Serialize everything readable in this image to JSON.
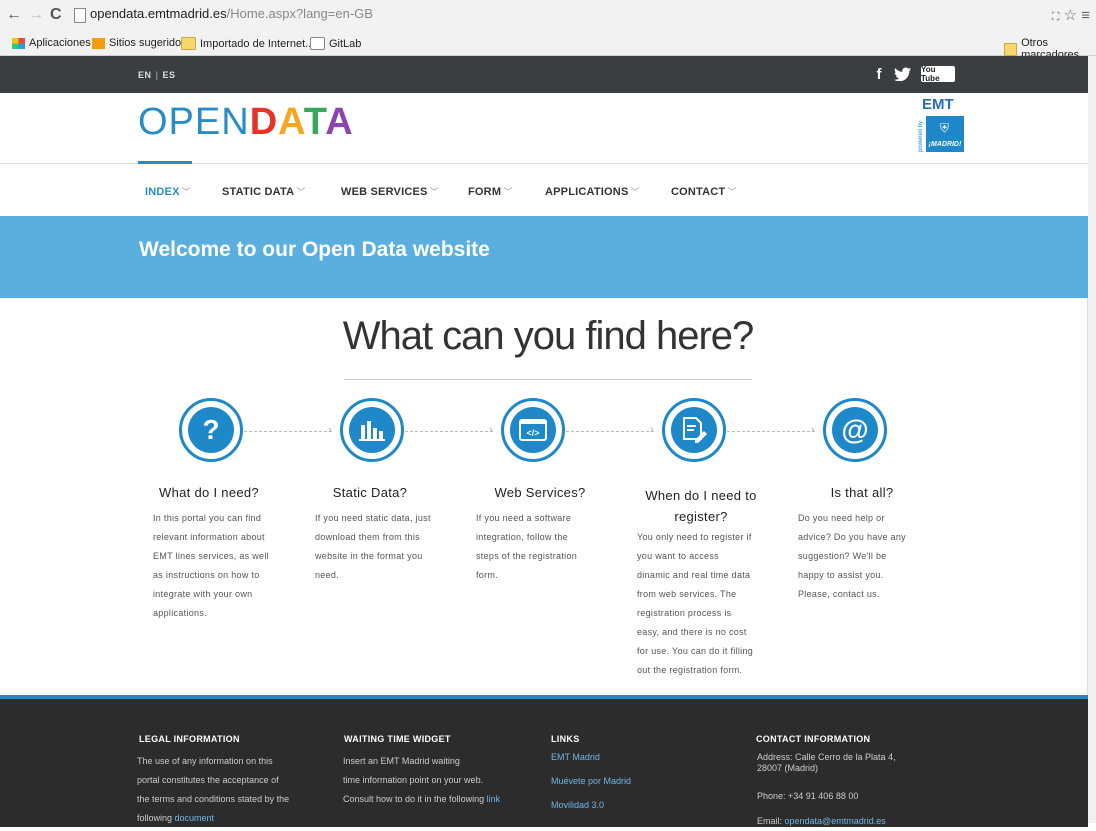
{
  "browser": {
    "url_host": "opendata.emtmadrid.es",
    "url_path": "/Home.aspx?lang=en-GB",
    "bookmarks": [
      "Aplicaciones",
      "Sitios sugeridos",
      "Importado de Internet...",
      "GitLab"
    ],
    "other_bookmarks": "Otros marcadores"
  },
  "topbar": {
    "lang_en": "EN",
    "lang_sep": "|",
    "lang_es": "ES",
    "social": [
      "f",
      "t",
      "You Tube"
    ]
  },
  "header": {
    "logo_open": "OPEN",
    "logo_data": [
      "D",
      "A",
      "T",
      "A"
    ],
    "emt": "EMT",
    "emt_madrid": "¡MADRID!",
    "powered": "powered by"
  },
  "nav": [
    {
      "label": "INDEX"
    },
    {
      "label": "STATIC DATA"
    },
    {
      "label": "WEB SERVICES"
    },
    {
      "label": "FORM"
    },
    {
      "label": "APPLICATIONS"
    },
    {
      "label": "CONTACT"
    }
  ],
  "banner": {
    "title": "Welcome to our Open Data website"
  },
  "main": {
    "title": "What can you find here?",
    "columns": [
      {
        "icon": "question-icon",
        "glyph": "?",
        "title": "What do I need?",
        "lines": [
          "In this portal you can find",
          "relevant information about",
          "EMT lines services, as well",
          "as instructions on how to",
          "integrate with your own",
          "applications."
        ]
      },
      {
        "icon": "bar-chart-icon",
        "glyph": "▮▮▮",
        "title": "Static Data?",
        "lines": [
          "If you need static data, just",
          "download them from this",
          "website in the format you",
          "need."
        ]
      },
      {
        "icon": "code-window-icon",
        "glyph": "</>",
        "title": "Web Services?",
        "lines": [
          "If you need a software",
          "integration, follow the",
          "steps of the registration",
          "form."
        ]
      },
      {
        "icon": "form-pen-icon",
        "glyph": "✎",
        "title": "When do I need to register?",
        "lines": [
          "You only need to register if",
          "you want to access",
          "dinamic and real time data",
          "from web services. The",
          "registration process is",
          "easy, and there is no cost",
          "for use. You can do it filling",
          "out the registration form."
        ]
      },
      {
        "icon": "at-sign-icon",
        "glyph": "@",
        "title": "Is that all?",
        "lines": [
          "Do you need help or",
          "advice? Do you have any",
          "suggestion? We'll be",
          "happy to assist you.",
          "Please, contact us."
        ]
      }
    ]
  },
  "footer": {
    "legal": {
      "heading": "LEGAL INFORMATION",
      "lines": [
        "The use of any information on this",
        "portal constitutes the acceptance of",
        "the terms and conditions stated by the"
      ],
      "last_prefix": "following ",
      "last_link": "document"
    },
    "widget": {
      "heading": "WAITING TIME WIDGET",
      "lines": [
        "Insert an EMT Madrid waiting",
        "time information point on your web."
      ],
      "last_prefix": "Consult how to do it in the following ",
      "last_link": "link"
    },
    "links": {
      "heading": "LINKS",
      "items": [
        "EMT Madrid",
        "Muévete por Madrid",
        "Movilidad 3.0"
      ]
    },
    "contact": {
      "heading": "CONTACT INFORMATION",
      "address1": "Address: Calle Cerro de la Plata 4,",
      "address2": "28007 (Madrid)",
      "phone": "Phone: +34 91 406 88 00",
      "email_prefix": "Email: ",
      "email": "opendata@emtmadrid.es"
    }
  }
}
